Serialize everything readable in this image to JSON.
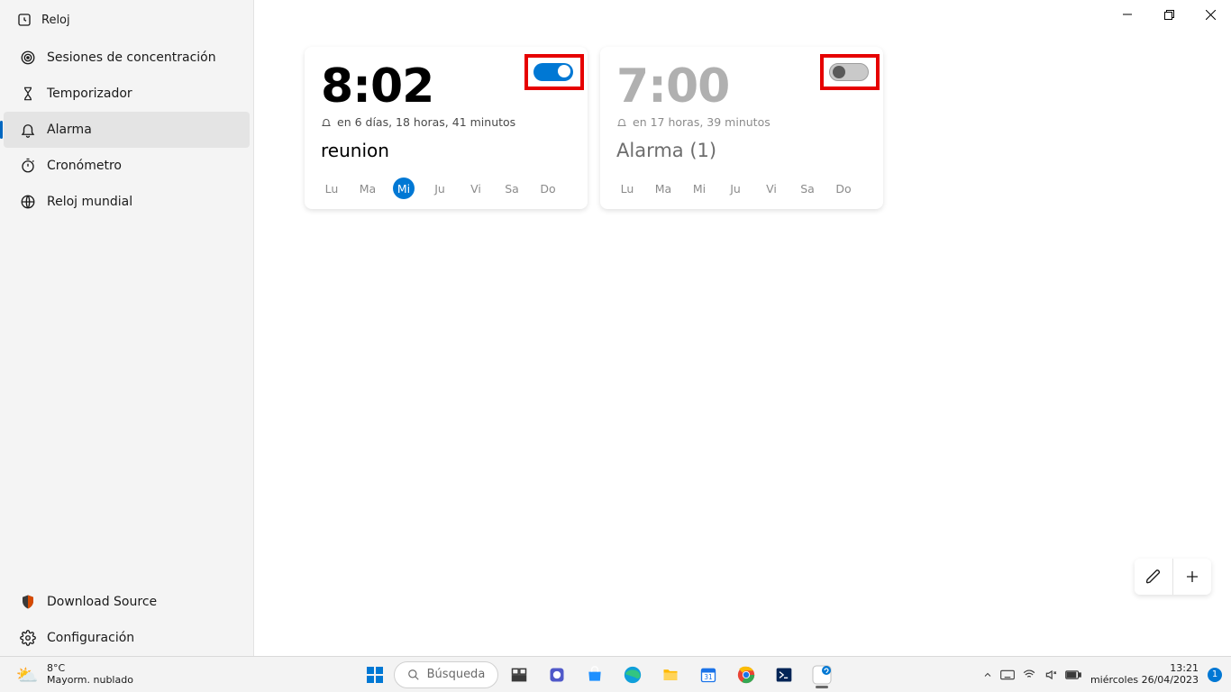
{
  "app_title": "Reloj",
  "sidebar": {
    "items": [
      {
        "label": "Sesiones de concentración",
        "icon": "target-icon"
      },
      {
        "label": "Temporizador",
        "icon": "hourglass-icon"
      },
      {
        "label": "Alarma",
        "icon": "bell-icon",
        "selected": true
      },
      {
        "label": "Cronómetro",
        "icon": "stopwatch-icon"
      },
      {
        "label": "Reloj mundial",
        "icon": "globe-icon"
      }
    ],
    "bottom": [
      {
        "label": "Download Source",
        "icon": "shield-icon"
      },
      {
        "label": "Configuración",
        "icon": "gear-icon"
      }
    ]
  },
  "alarms": [
    {
      "time": "8:02",
      "name": "reunion",
      "eta": "en 6 días, 18 horas, 41 minutos",
      "enabled": true,
      "days": [
        "Lu",
        "Ma",
        "Mi",
        "Ju",
        "Vi",
        "Sa",
        "Do"
      ],
      "active_days": [
        "Mi"
      ]
    },
    {
      "time": "7:00",
      "name": "Alarma (1)",
      "eta": "en 17 horas, 39 minutos",
      "enabled": false,
      "days": [
        "Lu",
        "Ma",
        "Mi",
        "Ju",
        "Vi",
        "Sa",
        "Do"
      ],
      "active_days": []
    }
  ],
  "fab": {
    "edit_tooltip": "Editar",
    "add_tooltip": "Agregar"
  },
  "window_controls": {
    "minimize": "Minimizar",
    "maximize": "Maximizar",
    "close": "Cerrar"
  },
  "taskbar": {
    "weather": {
      "temp": "8°C",
      "desc": "Mayorm. nublado"
    },
    "search_placeholder": "Búsqueda",
    "clock": {
      "time": "13:21",
      "date": "miércoles 26/04/2023"
    },
    "notifications": "1"
  }
}
